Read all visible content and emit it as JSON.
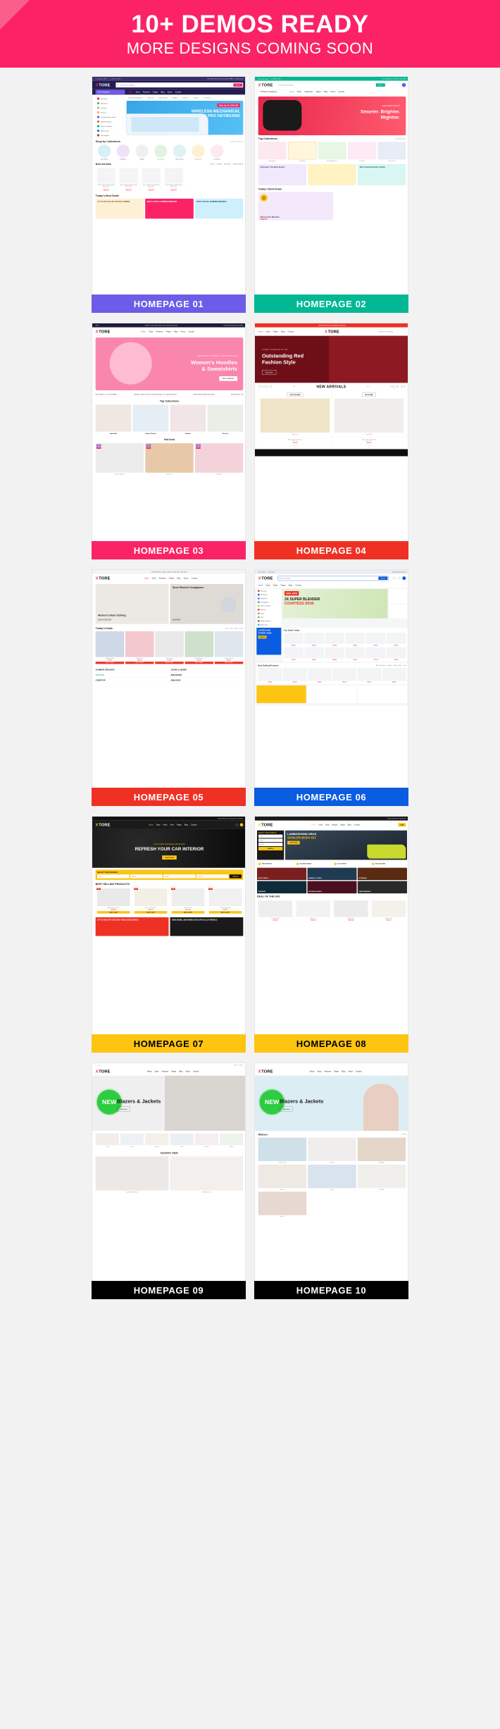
{
  "hero": {
    "title": "10+ DEMOS READY",
    "subtitle": "MORE DESIGNS COMING SOON",
    "bg_color": "#fb2366",
    "corner_color": "#fa5e8b"
  },
  "brand": {
    "name": "XTORE",
    "mark": "X",
    "rest": "TORE"
  },
  "demos": [
    {
      "id": 1,
      "label": "HOMEPAGE 01",
      "label_color": "#6c5ce7",
      "label_text_color": "#ffffff",
      "style": "electronics-purple",
      "topbar": {
        "left1": "Language: ENG",
        "left2": "Currency: USD",
        "right": "Get 15% off on any with code XTORE - Limited stock"
      },
      "search_placeholder": "Search for anything",
      "search_button": "Search",
      "category_button": "All Categories",
      "nav": [
        "Home",
        "Shop",
        "Features",
        "Pages",
        "Blog",
        "About",
        "Contact"
      ],
      "pills": [
        "Mechanical Keyboard",
        "iPhone 15",
        "Laptop Stand",
        "Gadgets",
        "Furniture",
        "Perfume",
        "Cosmetics"
      ],
      "hero_badge": "Sale Up To 30% Off",
      "hero_title_1": "WIRELESS MECHANICAL",
      "hero_title_2": "KB PRO KEYBOARD",
      "sidebar_items": [
        "Hot Deals",
        "Electronics",
        "Furniture",
        "Fashion",
        "Jewelry & Accessories",
        "Health & Beauty",
        "Sport & Outdoor",
        "Baby & Toys",
        "Pet Supplies"
      ],
      "section_1": "Shop by Collections",
      "section_1_link": "Load more Collections",
      "collections": [
        "Cell Phones",
        "Handbags",
        "Stroller",
        "Sportswear",
        "Sofa & Chair",
        "Headphones",
        "Cosmetics"
      ],
      "section_2": "New Arrivals",
      "tabs": [
        "Fashion",
        "Furniture",
        "Electronics",
        "Health & Beauty"
      ],
      "products": [
        {
          "name": "New Pad Air 128 GB Storage Black 2022",
          "price": "$259.00",
          "stars": "★★★★★"
        },
        {
          "name": "New Pad Air 128 GB Storage Black 2022",
          "price": "$259.00",
          "stars": "★★★★★"
        },
        {
          "name": "New Pad Air 128 GB Storage Black 2022",
          "price": "$259.00",
          "stars": "★★★★★"
        },
        {
          "name": "New Pad Air 128 GB Storage Black 2022",
          "price": "$259.00",
          "stars": "★★★★★"
        }
      ],
      "section_3": "Today's Best Deals",
      "promo_1": "UP TO 35% OFF ON THE BIG SUMMER",
      "promo_2": "BEST CASUAL SUMMER DRESSES"
    },
    {
      "id": 2,
      "label": "HOMEPAGE 02",
      "label_color": "#00b894",
      "label_text_color": "#ffffff",
      "style": "marketplace-green",
      "topbar": {
        "left1": "Track Order",
        "left2": "Help Center",
        "right": "Free Shipping On Orders Over $99"
      },
      "search_placeholder": "Search for products",
      "search_button": "Search",
      "category_button": "Shop by Categories",
      "nav": [
        "Home",
        "Shop",
        "Collections",
        "Pages",
        "Blog",
        "About",
        "Contact"
      ],
      "hero_kicker": "Apple Watch Series 9",
      "hero_title_1": "Smarter. Brighter.",
      "hero_title_2": "Mightier.",
      "hero_button": "Shop Now",
      "section_1": "Top Collections",
      "section_1_link": "View All Collections",
      "collections": [
        "Smartphones",
        "Handbags",
        "Kitchen Appliances",
        "Perfumes",
        "Sofa & Chair"
      ],
      "cards": [
        "Exclusive: The Best Sound",
        "Best Casual Summer Outfits"
      ],
      "section_3": "Today's Best Deals",
      "deal_name": "iPhone 15 Pro Max Titan",
      "deal_price": "$499.00"
    },
    {
      "id": 3,
      "label": "HOMEPAGE 03",
      "label_color": "#fb2366",
      "label_text_color": "#ffffff",
      "style": "fashion-pink",
      "topbar": {
        "left1": "FREE",
        "left2": "LIMITED TIME OFFER: ENJOY EXCLUSIVE DISCOUNT",
        "right": "FREE SHIPPING AND RETURNS"
      },
      "nav": [
        "Home",
        "Shop",
        "Features",
        "Pages",
        "Blog",
        "About",
        "Contact"
      ],
      "hero_kicker": "EXCITING YOUTHFUL FASHION STYLE",
      "hero_title_1": "Women's Hoodies",
      "hero_title_2": "& Sweatshirts",
      "hero_button": "Shop Collection",
      "marquee": [
        "HIGH QUALITY COTTON FABRIC",
        "LARGEST TIME OPTION FOR WHOLESALE YOU CAN FIND BEST",
        "FREE SHIPPING AND RETURNS",
        "NEW DESIGN: 180"
      ],
      "section_1": "Top Collections",
      "collections": [
        "Sport Bra",
        "Jeans & Denim",
        "Sweater",
        "Dresses"
      ],
      "section_2": "Hot Deal",
      "products": [
        "Black Leggings",
        "White Tee",
        "Pink Blazer"
      ]
    },
    {
      "id": 4,
      "label": "HOMEPAGE 04",
      "label_color": "#ee3124",
      "label_text_color": "#ffffff",
      "style": "fashion-red",
      "topbar": {
        "right": "FREE SHIPPING ON ORDERS OVER $50"
      },
      "search_placeholder": "Search for anything",
      "nav": [
        "Home",
        "Shop",
        "Pages",
        "Blog",
        "Contact"
      ],
      "hero_kicker": "FLASHY FASHION STYLE",
      "hero_title_1": "Outstanding Red",
      "hero_title_2": "Fashion Style",
      "hero_button": "Shop Now",
      "marquee": "NEW ARRIVALS",
      "cards": [
        {
          "title": "SHOP WOMEN",
          "name": "Yellow Coat"
        },
        {
          "title": "SHOP MEN",
          "name": "Check Shirt"
        }
      ],
      "products": [
        {
          "name": "Slim Cotton Chino Pants",
          "price": "$49.00",
          "stars": "★★★★★"
        },
        {
          "name": "Slim Cotton Chino Pants",
          "price": "$49.00",
          "stars": "★★★★★"
        }
      ]
    },
    {
      "id": 5,
      "label": "HOMEPAGE 05",
      "label_color": "#ee3124",
      "label_text_color": "#ffffff",
      "style": "lookbook-light",
      "topbar": {
        "right": "FREE SHIPPING ON ALL ORDERS OVER $99 - SHOP NOW"
      },
      "nav": [
        "Home",
        "Shop",
        "Features",
        "Pages",
        "Blog",
        "About",
        "Contact"
      ],
      "banner_1": "Women's Urban Clothing",
      "banner_1_link": "SHOP COLLECTION",
      "banner_2": "Gucci Women's Sunglasses",
      "banner_2_link": "SHOP NOW",
      "section_2": "Today's Deals",
      "countdown": "3 Day : 12 Hrs : 47 Min : 18 Sec",
      "products": [
        {
          "name": "Denim Jacket",
          "price": "$79.00"
        },
        {
          "name": "Pink Blouse",
          "price": "$45.00"
        },
        {
          "name": "Cotton Socks",
          "price": "$12.00"
        },
        {
          "name": "Green Sweater",
          "price": "$59.00"
        },
        {
          "name": "Denim Overall",
          "price": "$89.00"
        }
      ],
      "tag_list": [
        "SUMMER DRESSES",
        "JEANS & DENIM",
        "VINTAGE",
        "SNEAKERS",
        "CROPTOP",
        "SWEATER"
      ]
    },
    {
      "id": 6,
      "label": "HOMEPAGE 06",
      "label_color": "#0a5ce0",
      "label_text_color": "#ffffff",
      "style": "megashop-blue",
      "topbar": {
        "left1": "Sell on Xtore",
        "left2": "Track Order",
        "right": "Free Shipping Over $50"
      },
      "search_placeholder": "Search products",
      "search_button": "Search",
      "nav": [
        "Home",
        "Shop",
        "Deals",
        "Pages",
        "Blog",
        "Contact"
      ],
      "sidebar_items": [
        "Hot Deals",
        "Electronics",
        "Computers",
        "Smartphones",
        "Home & Garden",
        "Fashion",
        "Sport",
        "Toys",
        "Health & Beauty",
        "Automotive"
      ],
      "hero_badge": "54% OFF",
      "hero_title_1": "3X SUPER BLENDER",
      "hero_title_2": "COUNTESS SK56",
      "banner_left": "LOGITECH MX3",
      "banner_left_sub": "SUPER VIEW",
      "banner_price": "$109.00",
      "section_1": "Top Deals Today",
      "section_2": "Best Selling Products",
      "tabs": [
        "All",
        "Electronics",
        "Fashion",
        "Home",
        "Sport",
        "Toys"
      ]
    },
    {
      "id": 7,
      "label": "HOMEPAGE 07",
      "label_color": "#fdc412",
      "label_text_color": "#000000",
      "style": "auto-dark",
      "topbar": {
        "right": "FREE SHIPPING ON ORDERS OVER $199"
      },
      "nav": [
        "Home",
        "Shop",
        "Parts",
        "Tires",
        "Pages",
        "Blog",
        "Contact"
      ],
      "hero_kicker": "CAR CARE PACKAGE FROM $39",
      "hero_title": "REFRESH YOUR CAR INTERIOR",
      "hero_button": "SHOP NOW",
      "finder_title": "SELECT YOUR VEHICLE",
      "finder_fields": [
        "Year",
        "Make",
        "Model",
        "Engine"
      ],
      "finder_button": "SEARCH",
      "section_1": "BEST SELLING PRODUCTS",
      "products": [
        {
          "name": "Alloy Wheel Rim 18\"",
          "price": "$299.00"
        },
        {
          "name": "Motor Oil 5W-30 5L",
          "price": "$39.00"
        },
        {
          "name": "Brake Disc Set",
          "price": "$129.00"
        },
        {
          "name": "LED Headlight Bulb",
          "price": "$59.00"
        }
      ],
      "promo_1": "UP TO 40% OFF CAR LIGHT AND ACCESSORIES",
      "promo_2": "NEW MODEL 2024 MODULAR ULTRA ALLOY WHEELS"
    },
    {
      "id": 8,
      "label": "HOMEPAGE 08",
      "label_color": "#fdc412",
      "label_text_color": "#000000",
      "style": "auto-yellow",
      "topbar": {
        "right": "FREE SHIPPING WORLDWIDE"
      },
      "nav": [
        "Home",
        "Shop",
        "Parts",
        "Brands",
        "Pages",
        "Blog",
        "Contact"
      ],
      "finder_title": "SELECT YOUR VEHICLE",
      "finder_fields": [
        "Year",
        "Make",
        "Model"
      ],
      "finder_button": "SEARCH",
      "hero_kicker": "LAMBORGHINI URUS",
      "hero_title": "SPOILER BODY KIT",
      "hero_button": "SHOP NOW",
      "features": [
        "FREE SHIPPING",
        "SECURE PAYMENT",
        "24/7 SUPPORT",
        "EASY RETURNS"
      ],
      "categories": [
        "BODY PARTS",
        "WHEELS & TIRES",
        "EXTERIOR",
        "INTERIOR",
        "EXTERIOR PARTS",
        "PERFORMANCE"
      ],
      "section_1": "DEAL OF THE DAY",
      "products": [
        {
          "name": "Brake Pad Set",
          "price": "$89.00"
        },
        {
          "name": "Exhaust Tip",
          "price": "$49.00"
        },
        {
          "name": "Alloy Wheel",
          "price": "$299.00"
        },
        {
          "name": "Engine Oil 5L",
          "price": "$39.00"
        }
      ]
    },
    {
      "id": 9,
      "label": "HOMEPAGE 09",
      "label_color": "#000000",
      "label_text_color": "#ffffff",
      "style": "minimal-blazer",
      "badge": "NEW",
      "nav": [
        "Home",
        "Shop",
        "Features",
        "Pages",
        "Blog",
        "About",
        "Contact"
      ],
      "hero_title": "Blazers & Jackets",
      "hero_button": "Shop Now",
      "collections": [
        "T-shirt",
        "Shirts",
        "Jackets",
        "Pants",
        "Dresses",
        "Shoes"
      ],
      "section_2": "Dynamic Style",
      "products": [
        "Leather Bag & Shorts",
        "White Tank Top"
      ]
    },
    {
      "id": 10,
      "label": "HOMEPAGE 10",
      "label_color": "#000000",
      "label_text_color": "#ffffff",
      "style": "minimal-blue",
      "badge": "NEW",
      "nav": [
        "Home",
        "Shop",
        "Features",
        "Pages",
        "Blog",
        "About",
        "Contact"
      ],
      "hero_title": "Blazers & Jackets",
      "hero_button": "Shop Now",
      "section_1": "Women",
      "section_1_link": "View All",
      "products": [
        {
          "name": "Denim Jacket"
        },
        {
          "name": "Tank Top"
        },
        {
          "name": "Handbags"
        },
        {
          "name": "Blazers"
        },
        {
          "name": "Shorts"
        },
        {
          "name": "Sandals"
        },
        {
          "name": "Blouse"
        }
      ]
    }
  ]
}
